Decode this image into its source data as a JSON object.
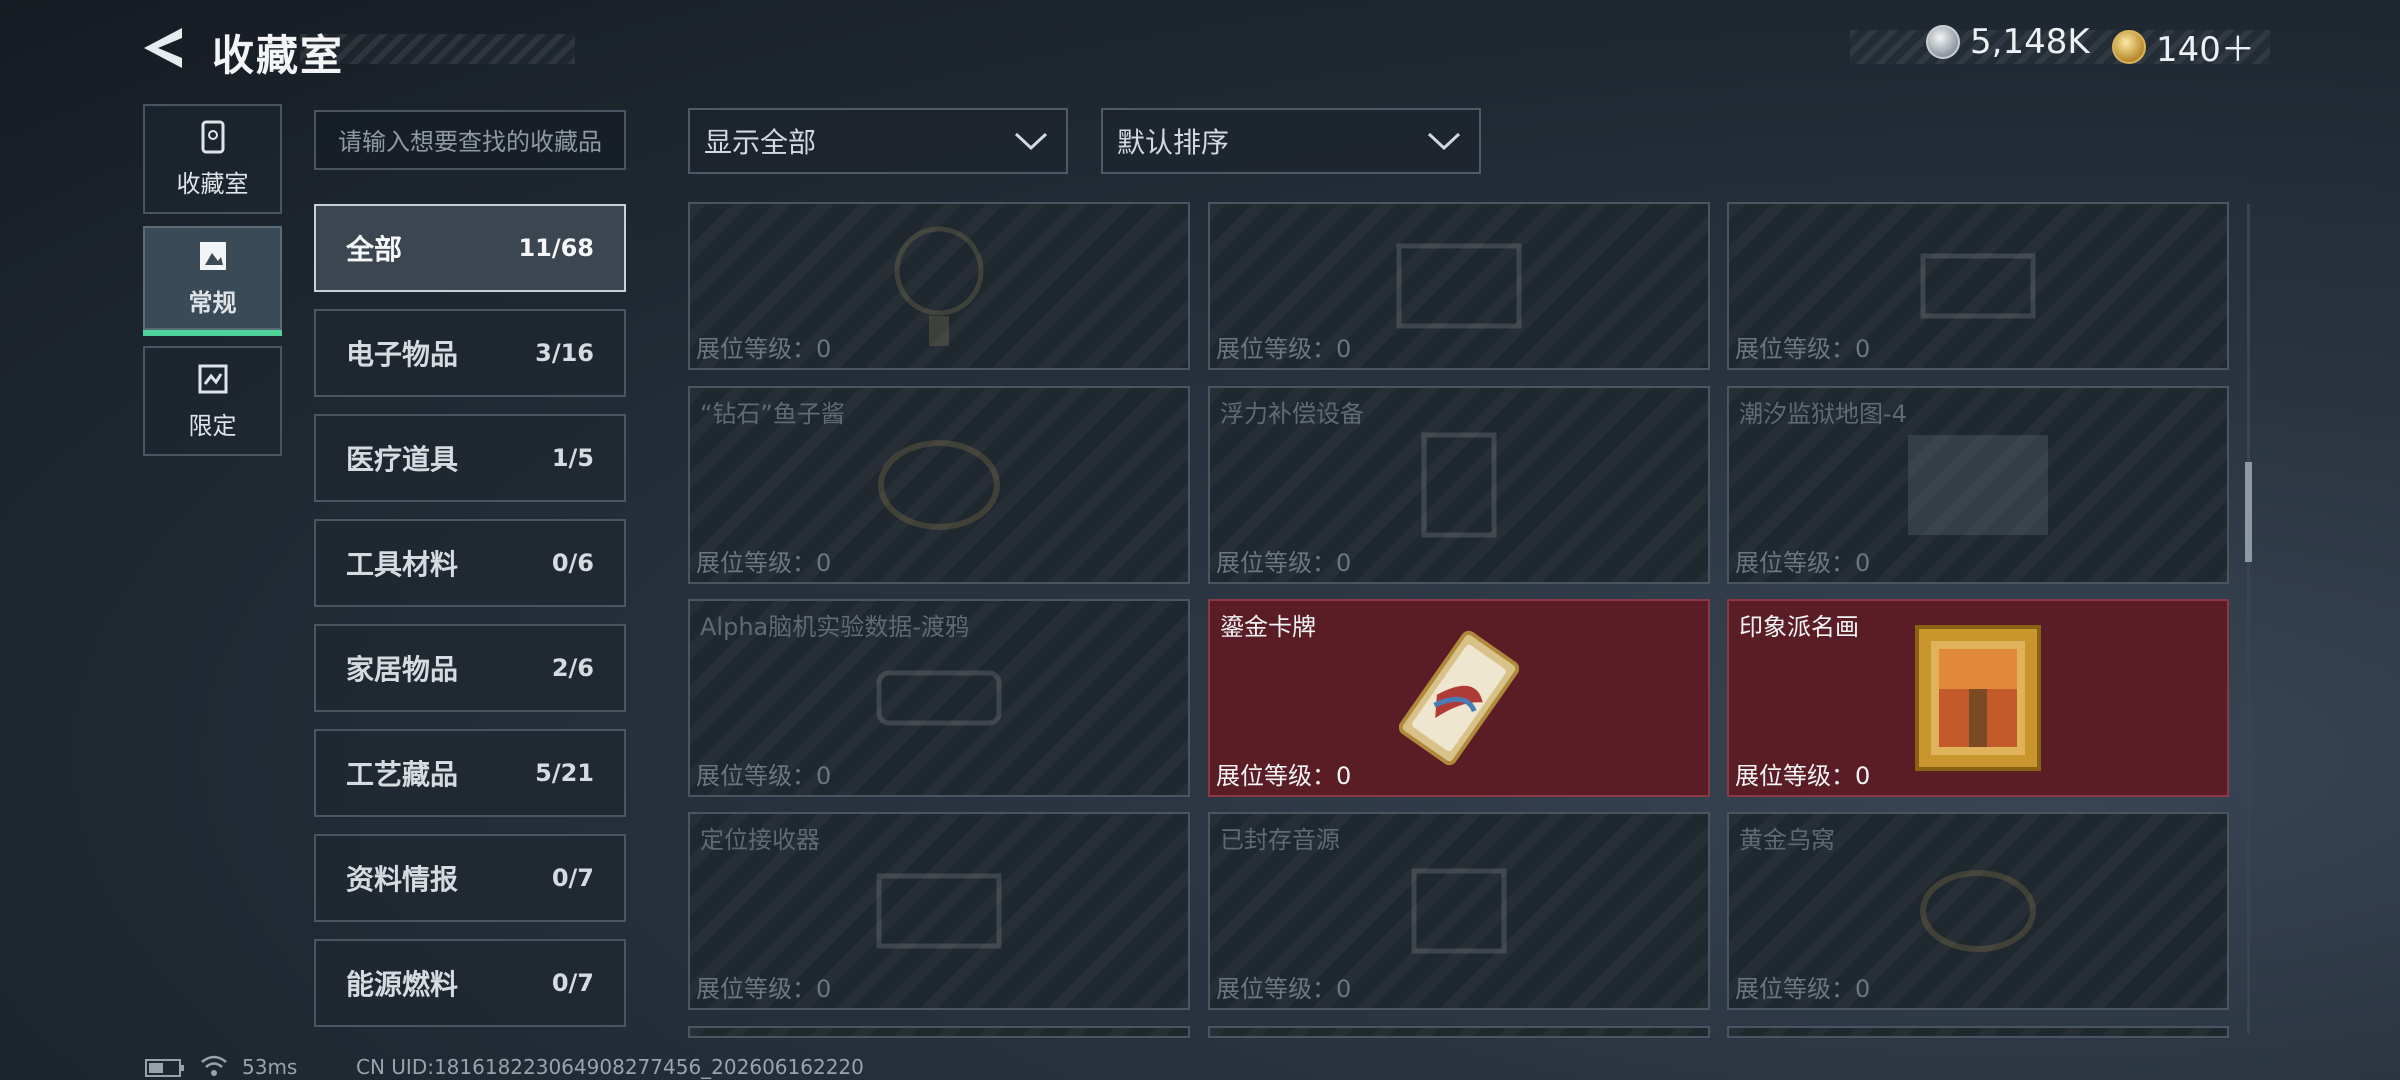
{
  "header": {
    "title": "收藏室",
    "currency": [
      {
        "icon": "silver-coin-icon",
        "value": "5,148K"
      },
      {
        "icon": "gold-coin-icon",
        "value": "140＋"
      }
    ]
  },
  "side_nav": [
    {
      "icon": "collection-room-icon",
      "label": "收藏室"
    },
    {
      "icon": "regular-icon",
      "label": "常规",
      "active": true
    },
    {
      "icon": "limited-icon",
      "label": "限定"
    }
  ],
  "search": {
    "placeholder": "请输入想要查找的收藏品"
  },
  "categories": [
    {
      "label": "全部",
      "count": "11/68",
      "active": true
    },
    {
      "label": "电子物品",
      "count": "3/16"
    },
    {
      "label": "医疗道具",
      "count": "1/5"
    },
    {
      "label": "工具材料",
      "count": "0/6"
    },
    {
      "label": "家居物品",
      "count": "2/6"
    },
    {
      "label": "工艺藏品",
      "count": "5/21"
    },
    {
      "label": "资料情报",
      "count": "0/7"
    },
    {
      "label": "能源燃料",
      "count": "0/7"
    }
  ],
  "filters": {
    "display": "显示全部",
    "sort": "默认排序"
  },
  "items": [
    {
      "name": "",
      "level": "展位等级：0",
      "owned": false
    },
    {
      "name": "",
      "level": "展位等级：0",
      "owned": false
    },
    {
      "name": "",
      "level": "展位等级：0",
      "owned": false
    },
    {
      "name": "“钻石”鱼子酱",
      "level": "展位等级：0",
      "owned": false
    },
    {
      "name": "浮力补偿设备",
      "level": "展位等级：0",
      "owned": false
    },
    {
      "name": "潮汐监狱地图-4",
      "level": "展位等级：0",
      "owned": false
    },
    {
      "name": "Alpha脑机实验数据-渡鸦",
      "level": "展位等级：0",
      "owned": false
    },
    {
      "name": "鎏金卡牌",
      "level": "展位等级：0",
      "owned": true
    },
    {
      "name": "印象派名画",
      "level": "展位等级：0",
      "owned": true
    },
    {
      "name": "定位接收器",
      "level": "展位等级：0",
      "owned": false
    },
    {
      "name": "已封存音源",
      "level": "展位等级：0",
      "owned": false
    },
    {
      "name": "黄金乌窝",
      "level": "展位等级：0",
      "owned": false
    }
  ],
  "footer": {
    "latency": "53ms",
    "uid": "CN UID:1816182230649082774​56_202606162220"
  },
  "colors": {
    "accent_green": "#4fd39a",
    "owned_card": "#5a1d25"
  }
}
